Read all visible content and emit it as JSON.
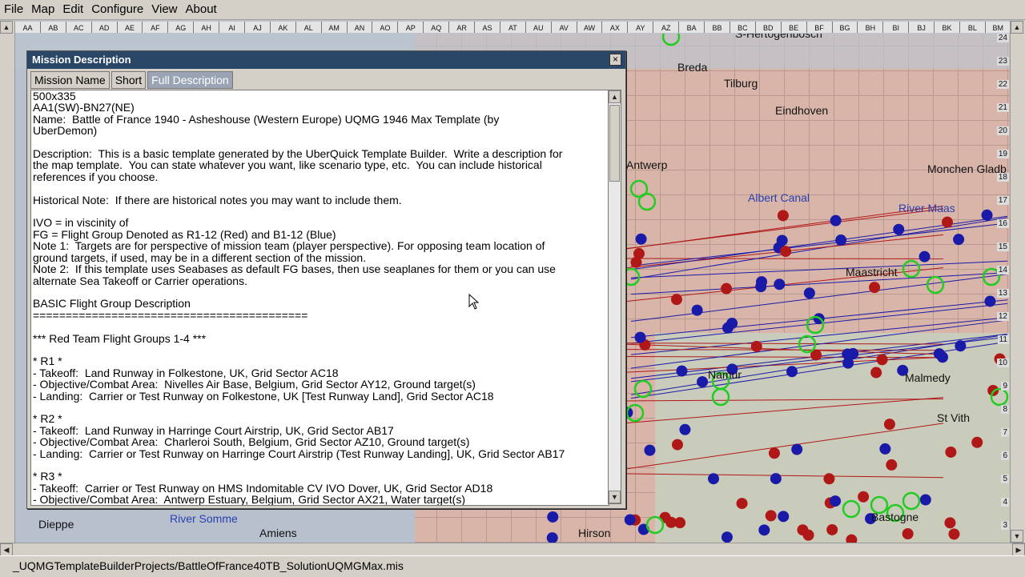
{
  "menu": [
    "File",
    "Map",
    "Edit",
    "Configure",
    "View",
    "About"
  ],
  "map": {
    "columns": [
      "AA",
      "AB",
      "AC",
      "AD",
      "AE",
      "AF",
      "AG",
      "AH",
      "AI",
      "AJ",
      "AK",
      "AL",
      "AM",
      "AN",
      "AO",
      "AP",
      "AQ",
      "AR",
      "AS",
      "AT",
      "AU",
      "AV",
      "AW",
      "AX",
      "AY",
      "AZ",
      "BA",
      "BB",
      "BC",
      "BD",
      "BE",
      "BF",
      "BG",
      "BH",
      "BI",
      "BJ",
      "BK",
      "BL",
      "BM"
    ],
    "rows": [
      "24",
      "23",
      "22",
      "21",
      "20",
      "19",
      "18",
      "17",
      "16",
      "15",
      "14",
      "13",
      "12",
      "11",
      "10",
      "9",
      "8",
      "7",
      "6",
      "5",
      "4",
      "3"
    ],
    "labels": {
      "s_hertogenbosch": "S-Hertogenbosch",
      "breda": "Breda",
      "tilburg": "Tilburg",
      "eindhoven": "Eindhoven",
      "antwerp": "Antwerp",
      "albert_canal": "Albert Canal",
      "monchen_gladb": "Monchen Gladb",
      "river_maas": "River Maas",
      "maastricht": "Maastricht",
      "malmedy": "Malmedy",
      "st_vith": "St Vith",
      "namur": "Namur",
      "dieppe": "Dieppe",
      "river_somme": "River Somme",
      "amiens": "Amiens",
      "hirson": "Hirson",
      "bastogne": "Bastogne"
    }
  },
  "dialog": {
    "title": "Mission Description",
    "close": "×",
    "tabs": [
      "Mission Name",
      "Short",
      "Full Description"
    ],
    "active_tab": "Full Description",
    "lines": [
      "500x335",
      "AA1(SW)-BN27(NE)",
      "Name:  Battle of France 1940 - Asheshouse (Western Europe) UQMG 1946 Max Template (by",
      "UberDemon)",
      "",
      "Description:  This is a basic template generated by the UberQuick Template Builder.  Write a description for",
      "the map template.  You can state whatever you want, like scenario type, etc.  You can include historical",
      "references if you choose.",
      "",
      "Historical Note:  If there are historical notes you may want to include them.",
      "",
      "IVO = in viscinity of",
      "FG = Flight Group Denoted as R1-12 (Red) and B1-12 (Blue)",
      "Note 1:  Targets are for perspective of mission team (player perspective). For opposing team location of",
      "ground targets, if used, may be in a different section of the mission.",
      "Note 2:  If this template uses Seabases as default FG bases, then use seaplanes for them or you can use",
      "alternate Sea Takeoff or Carrier operations.",
      "",
      "BASIC Flight Group Description",
      "==========================================",
      "",
      "*** Red Team Flight Groups 1-4 ***",
      "",
      "* R1 *",
      "- Takeoff:  Land Runway in Folkestone, UK, Grid Sector AC18",
      "- Objective/Combat Area:  Nivelles Air Base, Belgium, Grid Sector AY12, Ground target(s)",
      "- Landing:  Carrier or Test Runway on Folkestone, UK [Test Runway Land], Grid Sector AC18",
      "",
      "* R2 *",
      "- Takeoff:  Land Runway in Harringe Court Airstrip, UK, Grid Sector AB17",
      "- Objective/Combat Area:  Charleroi South, Belgium, Grid Sector AZ10, Ground target(s)",
      "- Landing:  Carrier or Test Runway on Harringe Court Airstrip (Test Runway Landing], UK, Grid Sector AB17",
      "",
      "* R3 *",
      "- Takeoff:  Carrier or Test Runway on HMS Indomitable CV IVO Dover, UK, Grid Sector AD18",
      "- Objective/Combat Area:  Antwerp Estuary, Belgium, Grid Sector AX21, Water target(s)"
    ]
  },
  "status": {
    "path": "_UQMGTemplateBuilderProjects/BattleOfFrance40TB_SolutionUQMGMax.mis"
  },
  "colors": {
    "title_bar": "#2b4768",
    "red_unit": "#b01818",
    "blue_unit": "#1a1aa8",
    "green_ring": "#22cc22"
  }
}
